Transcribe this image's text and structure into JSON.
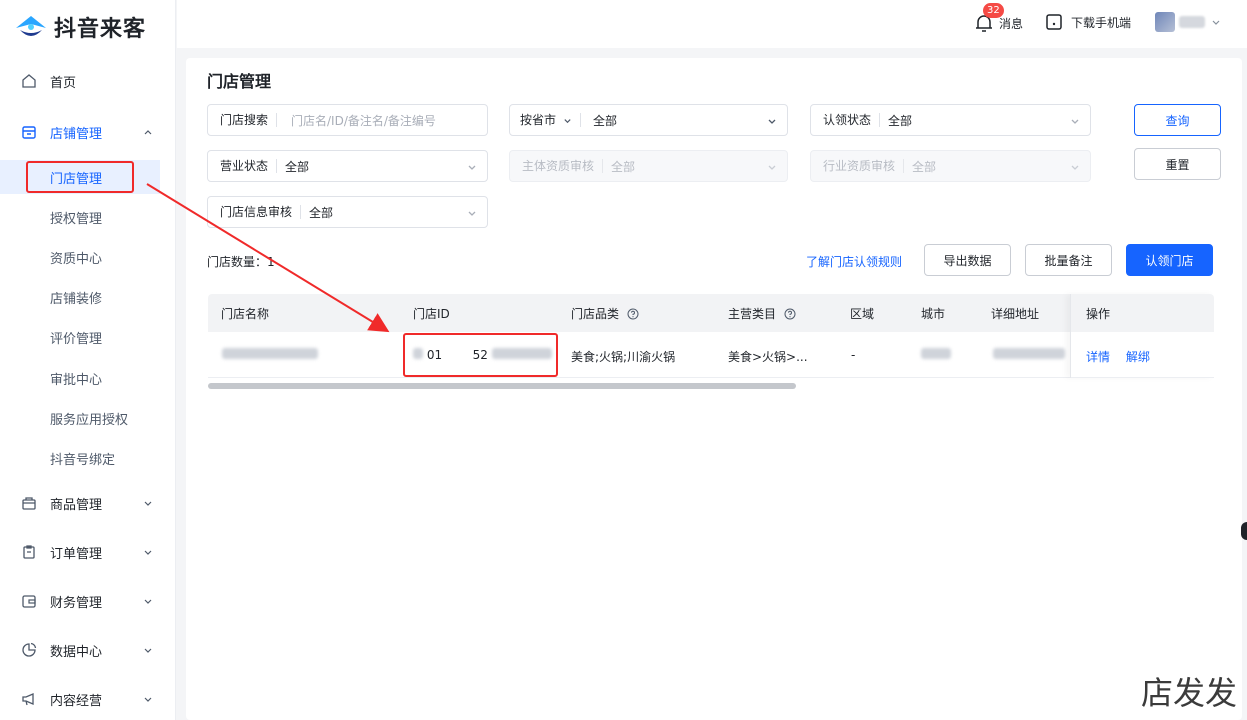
{
  "app": {
    "name": "抖音来客"
  },
  "colors": {
    "accent": "#1664ff",
    "badge": "#f54a45",
    "annotation": "#f02a2a"
  },
  "sidebar": {
    "items": [
      {
        "label": "首页",
        "icon": "home-icon"
      },
      {
        "label": "店铺管理",
        "icon": "store-icon",
        "expanded": true,
        "children": [
          "门店管理",
          "授权管理",
          "资质中心",
          "店铺装修",
          "评价管理",
          "审批中心",
          "服务应用授权",
          "抖音号绑定"
        ]
      },
      {
        "label": "商品管理",
        "icon": "bag-icon"
      },
      {
        "label": "订单管理",
        "icon": "clipboard-icon"
      },
      {
        "label": "财务管理",
        "icon": "wallet-icon"
      },
      {
        "label": "数据中心",
        "icon": "pie-chart-icon"
      },
      {
        "label": "内容经营",
        "icon": "megaphone-icon"
      }
    ],
    "active_child": "门店管理"
  },
  "topbar": {
    "message_label": "消息",
    "message_badge": "32",
    "download_label": "下载手机端"
  },
  "page": {
    "title": "门店管理"
  },
  "filters": {
    "search": {
      "label": "门店搜索",
      "placeholder": "门店名/ID/备注名/备注编号"
    },
    "province": {
      "label": "按省市",
      "value": "全部"
    },
    "claim_status": {
      "label": "认领状态",
      "value": "全部"
    },
    "business_status": {
      "label": "营业状态",
      "value": "全部"
    },
    "entity_review": {
      "label": "主体资质审核",
      "value": "全部"
    },
    "industry_review": {
      "label": "行业资质审核",
      "value": "全部"
    },
    "info_review": {
      "label": "门店信息审核",
      "value": "全部"
    }
  },
  "actions": {
    "query": "查询",
    "reset": "重置",
    "rules_link": "了解门店认领规则",
    "export": "导出数据",
    "batch_note": "批量备注",
    "claim": "认领门店"
  },
  "store_count_label": "门店数量：1",
  "table": {
    "columns": [
      "门店名称",
      "门店ID",
      "门店品类",
      "主营类目",
      "区域",
      "城市",
      "详细地址",
      "操作"
    ],
    "rows": [
      {
        "name": "",
        "id_visible": "01        52",
        "category": "美食;火锅;川渝火锅",
        "main_category": "美食>火锅>...",
        "region": "-",
        "city": "",
        "address": "",
        "ops": [
          "详情",
          "解绑"
        ]
      }
    ]
  },
  "corner_text": "店发发"
}
